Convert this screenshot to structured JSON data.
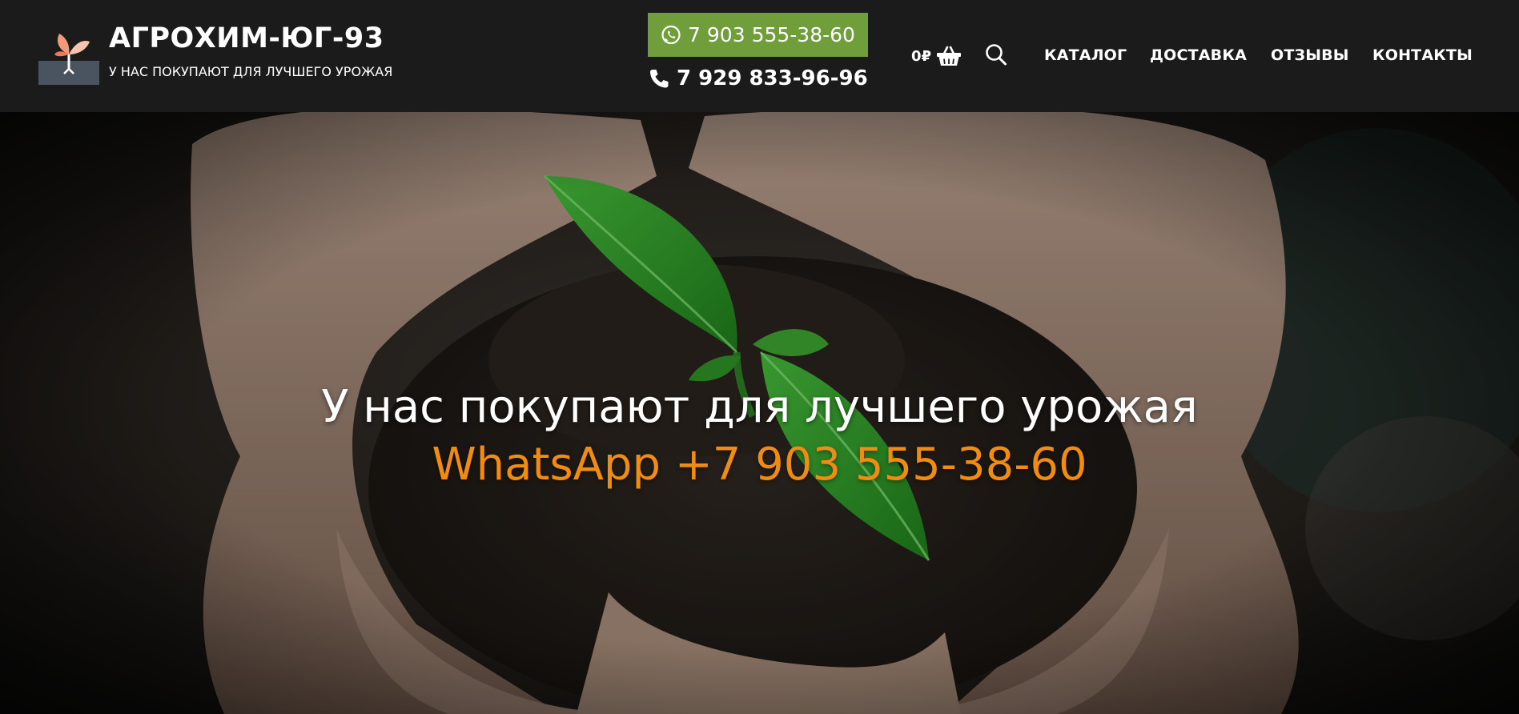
{
  "header": {
    "brand_title": "АГРОХИМ-ЮГ-93",
    "brand_tagline": "У НАС ПОКУПАЮТ ДЛЯ ЛУЧШЕГО УРОЖАЯ",
    "whatsapp_phone": "7 903 555-38-60",
    "phone": "7 929 833-96-96",
    "cart_total": "0₽",
    "nav": [
      "КАТАЛОГ",
      "ДОСТАВКА",
      "ОТЗЫВЫ",
      "КОНТАКТЫ"
    ],
    "icons": {
      "logo": "sprout-logo",
      "whatsapp": "whatsapp-icon",
      "phone": "phone-icon",
      "cart": "basket-icon",
      "search": "search-icon"
    }
  },
  "hero": {
    "title": "У нас покупают для лучшего урожая",
    "phone_line": "WhatsApp +7 903 555-38-60",
    "image": "hands-holding-soil-with-seedling"
  },
  "colors": {
    "header_bg": "#1b1b1b",
    "whatsapp_button": "#6f9e3a",
    "accent_orange": "#f08c12",
    "logo_petal": "#f09a78"
  }
}
